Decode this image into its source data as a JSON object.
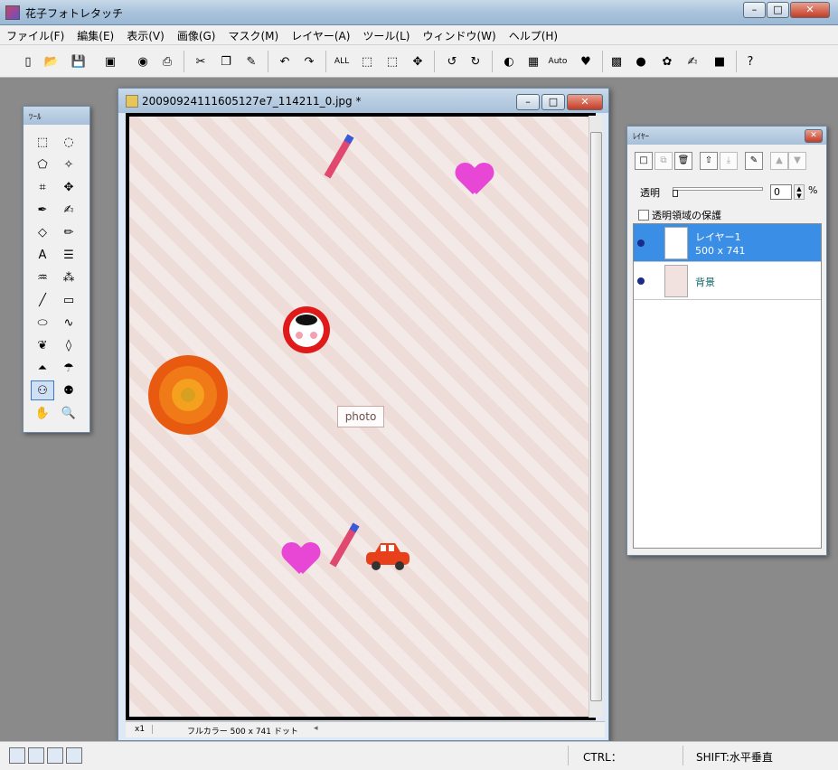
{
  "window": {
    "title": "花子フォトレタッチ",
    "controls": [
      "minimize",
      "maximize",
      "close"
    ]
  },
  "menu": [
    "ファイル(F)",
    "編集(E)",
    "表示(V)",
    "画像(G)",
    "マスク(M)",
    "レイヤー(A)",
    "ツール(L)",
    "ウィンドウ(W)",
    "ヘルプ(H)"
  ],
  "toolbar": [
    {
      "icon": "new-file-icon",
      "glyph": "▯"
    },
    {
      "icon": "open-folder-icon",
      "glyph": "📂"
    },
    {
      "icon": "save-icon",
      "glyph": "💾"
    },
    {
      "icon": "scan-icon",
      "glyph": "▣"
    },
    {
      "icon": "camera-icon",
      "glyph": "◉"
    },
    {
      "icon": "print-icon",
      "glyph": "⎙"
    },
    {
      "icon": "cut-icon",
      "glyph": "✂"
    },
    {
      "icon": "copy-icon",
      "glyph": "❐"
    },
    {
      "icon": "paste-icon",
      "glyph": "✎"
    },
    {
      "icon": "undo-icon",
      "glyph": "↶"
    },
    {
      "icon": "redo-icon",
      "glyph": "↷"
    },
    {
      "icon": "select-all-icon",
      "glyph": "ALL"
    },
    {
      "icon": "select-none-icon",
      "glyph": "⬚"
    },
    {
      "icon": "invert-selection-icon",
      "glyph": "⬚"
    },
    {
      "icon": "move-icon",
      "glyph": "✥"
    },
    {
      "icon": "rotate-left-90-icon",
      "glyph": "↺"
    },
    {
      "icon": "rotate-right-90-icon",
      "glyph": "↻"
    },
    {
      "icon": "color-adjust-icon",
      "glyph": "◐"
    },
    {
      "icon": "image-adjust-icon",
      "glyph": "▦"
    },
    {
      "icon": "auto-adjust-icon",
      "glyph": "Auto"
    },
    {
      "icon": "heart-stamp-icon",
      "glyph": "♥"
    },
    {
      "icon": "frame-icon",
      "glyph": "▩"
    },
    {
      "icon": "sphere-icon",
      "glyph": "●"
    },
    {
      "icon": "paint-icon",
      "glyph": "✿"
    },
    {
      "icon": "brush-icon",
      "glyph": "✍"
    },
    {
      "icon": "square-icon",
      "glyph": "■"
    },
    {
      "icon": "help-icon",
      "glyph": "?"
    }
  ],
  "tools_palette": {
    "title": "ﾂｰﾙ",
    "tools": [
      {
        "icon": "rect-select-icon",
        "glyph": "⬚"
      },
      {
        "icon": "lasso-icon",
        "glyph": "◌"
      },
      {
        "icon": "poly-select-icon",
        "glyph": "⬠"
      },
      {
        "icon": "magic-wand-icon",
        "glyph": "✧"
      },
      {
        "icon": "crop-icon",
        "glyph": "⌗"
      },
      {
        "icon": "move-tool-icon",
        "glyph": "✥"
      },
      {
        "icon": "pen-icon",
        "glyph": "✒"
      },
      {
        "icon": "brush-tool-icon",
        "glyph": "✍"
      },
      {
        "icon": "eraser-icon",
        "glyph": "◇"
      },
      {
        "icon": "pencil-icon",
        "glyph": "✏"
      },
      {
        "icon": "text-icon",
        "glyph": "A"
      },
      {
        "icon": "textbox-icon",
        "glyph": "☰"
      },
      {
        "icon": "fill-icon",
        "glyph": "♒"
      },
      {
        "icon": "spray-icon",
        "glyph": "⁂"
      },
      {
        "icon": "line-icon",
        "glyph": "╱"
      },
      {
        "icon": "rectangle-icon",
        "glyph": "▭"
      },
      {
        "icon": "ellipse-icon",
        "glyph": "⬭"
      },
      {
        "icon": "curve-icon",
        "glyph": "∿"
      },
      {
        "icon": "smudge-icon",
        "glyph": "❦"
      },
      {
        "icon": "drop-icon",
        "glyph": "◊"
      },
      {
        "icon": "sharpen-icon",
        "glyph": "⏶"
      },
      {
        "icon": "umbrella-icon",
        "glyph": "☂"
      },
      {
        "icon": "stamp-icon",
        "glyph": "⚇"
      },
      {
        "icon": "clone-icon",
        "glyph": "⚉"
      },
      {
        "icon": "hand-icon",
        "glyph": "✋"
      },
      {
        "icon": "zoom-icon",
        "glyph": "🔍"
      }
    ],
    "active_index": 22
  },
  "document": {
    "title": "20090924111605127e7_114211_0.jpg *",
    "photo_placeholder": "photo",
    "zoom": "x1",
    "info": "フルカラー  500 x 741 ドット"
  },
  "layers_palette": {
    "title": "ﾚｲﾔｰ",
    "opacity_label": "透明",
    "opacity_value": "0",
    "opacity_unit": "%",
    "protect_label": "透明領域の保護",
    "layers": [
      {
        "name": "レイヤー1",
        "size": "500 x 741",
        "selected": true
      },
      {
        "name": "背景",
        "size": "",
        "selected": false
      }
    ]
  },
  "status": {
    "ctrl": "CTRL：",
    "shift": "SHIFT:水平垂直"
  },
  "colors": {
    "accent": "#3a8ee6",
    "heart": "#e846d4",
    "titlebar": "#a9c3dc"
  }
}
